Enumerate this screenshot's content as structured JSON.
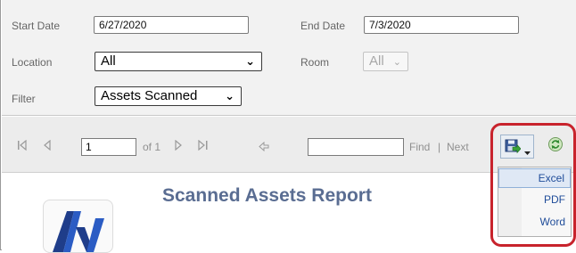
{
  "params": {
    "start_date_label": "Start Date",
    "start_date_value": "6/27/2020",
    "end_date_label": "End Date",
    "end_date_value": "7/3/2020",
    "location_label": "Location",
    "location_value": "All",
    "room_label": "Room",
    "room_value": "All",
    "filter_label": "Filter",
    "filter_value": "Assets Scanned"
  },
  "toolbar": {
    "page_value": "1",
    "of_pages": "of 1",
    "find_label": "Find",
    "separator": "|",
    "next_label": "Next",
    "icons": [
      "first-page-icon",
      "previous-page-icon",
      "next-page-icon",
      "last-page-icon",
      "back-icon",
      "save-icon",
      "refresh-icon"
    ]
  },
  "export_menu": {
    "items": [
      "Excel",
      "PDF",
      "Word"
    ]
  },
  "report": {
    "title": "Scanned Assets Report"
  },
  "colors": {
    "highlight_ring": "#c8232c",
    "title": "#5a6d92",
    "menu_text": "#1f4c99"
  }
}
